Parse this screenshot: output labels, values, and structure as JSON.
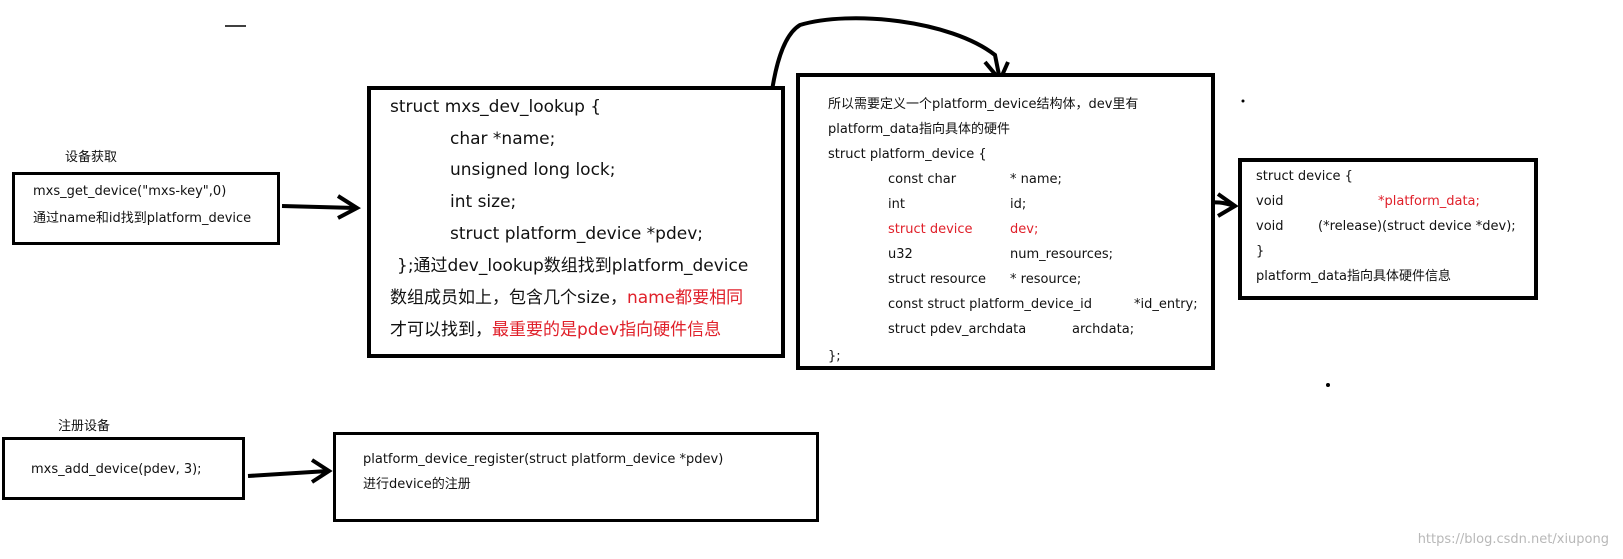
{
  "get_section": {
    "label": "设备获取",
    "lines": [
      "mxs_get_device(\"mxs-key\",0)",
      "通过name和id找到platform_device"
    ]
  },
  "lookup_box": {
    "lines": [
      "struct mxs_dev_lookup {",
      "char *name;",
      "unsigned long lock;",
      "int size;",
      "struct platform_device *pdev;",
      "};通过dev_lookup数组找到platform_device",
      "数组成员如上，包含几个size，",
      "name都要相同",
      "才可以找到，",
      "最重要的是pdev指向硬件信息"
    ]
  },
  "platform_box": {
    "lines": [
      "所以需要定义一个platform_device结构体，dev里有",
      "platform_data指向具体的硬件",
      "struct platform_device {",
      "};"
    ],
    "fields": [
      [
        "const char",
        "* name;"
      ],
      [
        "int",
        "id;"
      ],
      [
        "struct device",
        "dev;"
      ],
      [
        "u32",
        "num_resources;"
      ],
      [
        "struct resource",
        "* resource;"
      ],
      [
        "const struct platform_device_id",
        "*id_entry;"
      ],
      [
        "struct pdev_archdata",
        "archdata;"
      ]
    ]
  },
  "device_box": {
    "lines": [
      "struct device {",
      "void",
      "*platform_data;",
      "void",
      "(*release)(struct device *dev);",
      "}",
      "platform_data指向具体硬件信息"
    ]
  },
  "register_section": {
    "label": "注册设备",
    "call": "mxs_add_device(pdev, 3);",
    "lines": [
      "platform_device_register(struct platform_device *pdev)",
      "进行device的注册"
    ]
  },
  "watermark": "https://blog.csdn.net/xiupong",
  "colors": {
    "highlight": "#e0202a",
    "stroke": "#000000"
  }
}
